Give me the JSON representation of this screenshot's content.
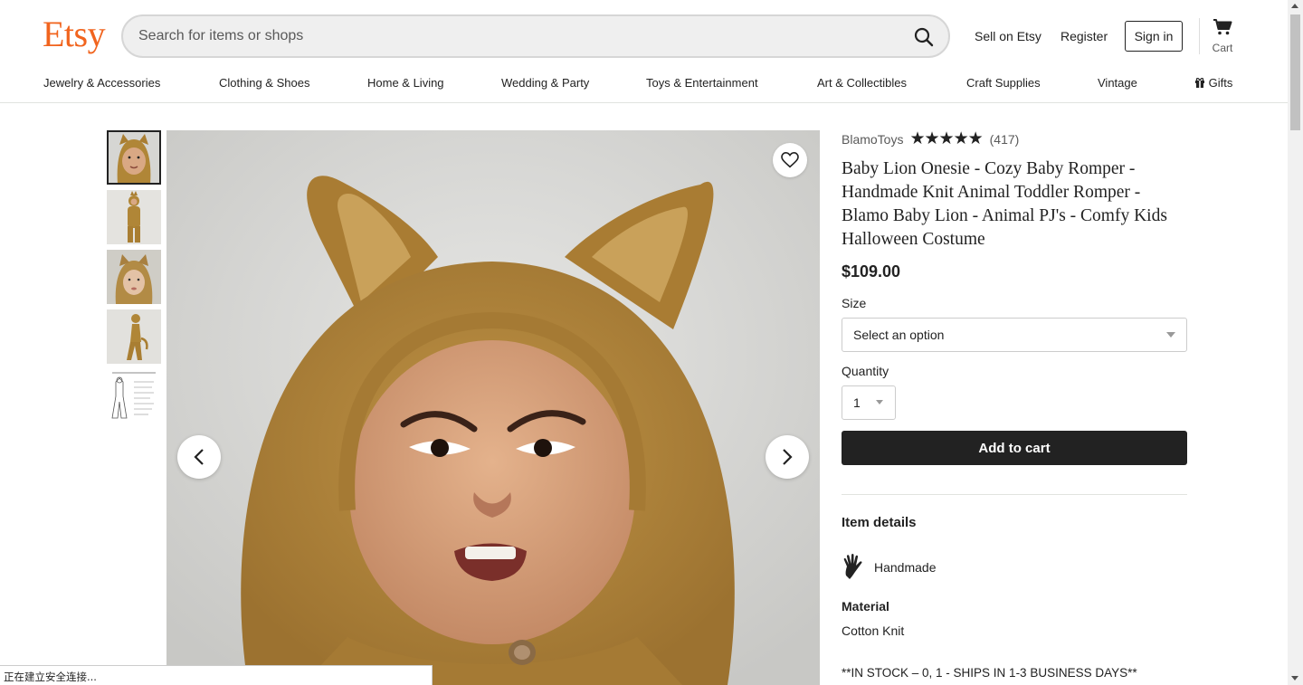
{
  "header": {
    "logo": "Etsy",
    "search_placeholder": "Search for items or shops",
    "sell_link": "Sell on Etsy",
    "register_link": "Register",
    "signin_button": "Sign in",
    "cart_label": "Cart"
  },
  "categories": [
    "Jewelry & Accessories",
    "Clothing & Shoes",
    "Home & Living",
    "Wedding & Party",
    "Toys & Entertainment",
    "Art & Collectibles",
    "Craft Supplies",
    "Vintage",
    "Gifts"
  ],
  "listing": {
    "shop_name": "BlamoToys",
    "rating_stars": "★★★★★",
    "rating_value": 5,
    "review_count": "(417)",
    "title": "Baby Lion Onesie - Cozy Baby Romper - Handmade Knit Animal Toddler Romper - Blamo Baby Lion - Animal PJ's - Comfy Kids Halloween Costume",
    "price": "$109.00",
    "size_label": "Size",
    "size_selected": "Select an option",
    "quantity_label": "Quantity",
    "quantity_selected": "1",
    "add_to_cart": "Add to cart",
    "item_details_head": "Item details",
    "handmade_label": "Handmade",
    "material_head": "Material",
    "material_value": "Cotton Knit",
    "stock_note": "**IN STOCK – 0, 1 - SHIPS IN 1-3 BUSINESS DAYS**"
  },
  "images": {
    "thumbnail_count": 5,
    "active_index": 0
  },
  "colors": {
    "brand": "#f1641e",
    "button_dark": "#222222"
  },
  "status_bar": "正在建立安全连接..."
}
